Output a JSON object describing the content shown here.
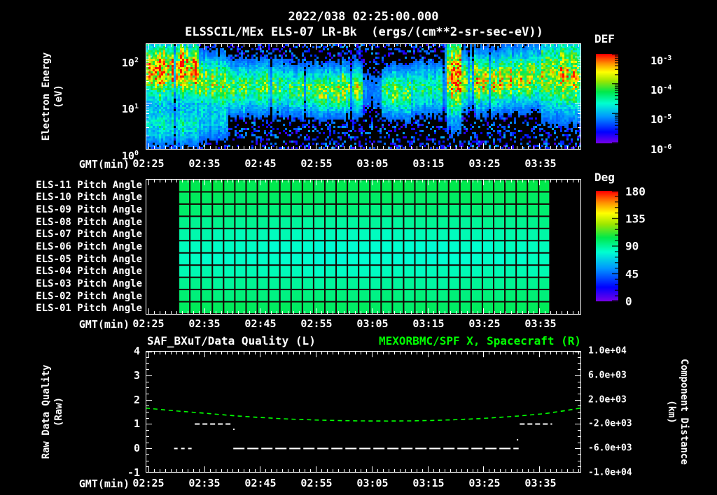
{
  "title": {
    "line1": "2022/038 02:25:00.000",
    "line2": "ELSSCIL/MEx ELS-07 LR-Bk  (ergs/(cm**2-sr-sec-eV))"
  },
  "colors": {
    "background": "#000000",
    "text": "#ffffff",
    "accent_green": "#00ff00",
    "panel_border": "#ffffff",
    "grid_line": "#150301"
  },
  "axis": {
    "gmt_label": "GMT(min)",
    "time_ticks": [
      "02:25",
      "02:35",
      "02:45",
      "02:55",
      "03:05",
      "03:15",
      "03:25",
      "03:35"
    ]
  },
  "panel1": {
    "ylabel_line1": "Electron Energy",
    "ylabel_line2": "(eV)",
    "yticks": [
      {
        "base": "10",
        "exp": "2"
      },
      {
        "base": "10",
        "exp": "1"
      },
      {
        "base": "10",
        "exp": "0"
      }
    ],
    "colorbar": {
      "title": "DEF",
      "tick_labels": [
        {
          "base": "10",
          "exp": "-3"
        },
        {
          "base": "10",
          "exp": "-4"
        },
        {
          "base": "10",
          "exp": "-5"
        },
        {
          "base": "10",
          "exp": "-6"
        }
      ]
    }
  },
  "panel2": {
    "row_labels": [
      "ELS-11 Pitch Angle",
      "ELS-10 Pitch Angle",
      "ELS-09 Pitch Angle",
      "ELS-08 Pitch Angle",
      "ELS-07 Pitch Angle",
      "ELS-06 Pitch Angle",
      "ELS-05 Pitch Angle",
      "ELS-04 Pitch Angle",
      "ELS-03 Pitch Angle",
      "ELS-02 Pitch Angle",
      "ELS-01 Pitch Angle"
    ],
    "colorbar": {
      "title": "Deg",
      "tick_labels": [
        "180",
        "135",
        "90",
        "45",
        "0"
      ]
    }
  },
  "panel3": {
    "title_left": "SAF_BXuT/Data Quality (L)",
    "title_right": "MEXORBMC/SPF X, Spacecraft (R)",
    "ylabel_left_line1": "Raw Data Quality",
    "ylabel_left_line2": "(Raw)",
    "ylabel_right_line1": "Component Distance",
    "ylabel_right_line2": "(km)",
    "yticks_left": [
      "4",
      "3",
      "2",
      "1",
      "0",
      "-1"
    ],
    "yticks_right": [
      "1.0e+04",
      "6.0e+03",
      "2.0e+03",
      "-2.0e+03",
      "-6.0e+03",
      "-1.0e+04"
    ]
  },
  "chart_data": [
    {
      "type": "heatmap",
      "name": "electron-energy-spectrogram",
      "title": "ELSSCIL/MEx ELS-07 LR-Bk",
      "units": "ergs/(cm**2-sr-sec-eV)",
      "colorbar_label": "DEF",
      "value_range": [
        "1e-6",
        "1e-3"
      ],
      "x_start_label": "02:25",
      "time_range_min": [
        -0.5,
        77.5
      ],
      "energy_log10_range": [
        0,
        2.28
      ],
      "rainbow_stops": [
        [
          0,
          "#7a00e6"
        ],
        [
          0.13,
          "#0000ff"
        ],
        [
          0.3,
          "#0096ff"
        ],
        [
          0.45,
          "#00ffd0"
        ],
        [
          0.58,
          "#00e84a"
        ],
        [
          0.7,
          "#9ce600"
        ],
        [
          0.8,
          "#ffff00"
        ],
        [
          0.9,
          "#ff8c00"
        ],
        [
          1,
          "#ff0000"
        ]
      ],
      "band_segments": [
        {
          "t": [
            -0.5,
            9
          ],
          "a": 0.95,
          "c": 1.72,
          "w": 0.38,
          "low": [
            0.34,
            0.55,
            0.28
          ]
        },
        {
          "t": [
            9,
            14
          ],
          "a": 0.6,
          "c": 1.45,
          "w": 0.34,
          "low": [
            0.2,
            0.6,
            0.25
          ]
        },
        {
          "t": [
            14,
            25
          ],
          "a": 0.5,
          "c": 1.35,
          "w": 0.32
        },
        {
          "t": [
            25,
            31
          ],
          "a": 0.55,
          "c": 1.28,
          "w": 0.3
        },
        {
          "t": [
            31,
            38
          ],
          "a": 0.62,
          "c": 1.3,
          "w": 0.3
        },
        {
          "t": [
            38,
            41.5
          ],
          "a": 0.12,
          "c": 1.3,
          "w": 0.3
        },
        {
          "t": [
            41.5,
            47
          ],
          "a": 0.55,
          "c": 1.25,
          "w": 0.3
        },
        {
          "t": [
            47,
            53
          ],
          "a": 0.4,
          "c": 1.32,
          "w": 0.32
        },
        {
          "t": [
            53,
            56
          ],
          "a": 0.82,
          "c": 1.58,
          "w": 0.55
        },
        {
          "t": [
            56,
            63
          ],
          "a": 0.7,
          "c": 1.5,
          "w": 0.34
        },
        {
          "t": [
            63,
            70
          ],
          "a": 0.66,
          "c": 1.55,
          "w": 0.36
        },
        {
          "t": [
            70,
            77.5
          ],
          "a": 0.68,
          "c": 1.62,
          "w": 0.5
        }
      ]
    },
    {
      "type": "heatmap",
      "name": "pitch-angle-panel",
      "colorbar_label": "Deg",
      "deg_range": [
        0,
        180
      ],
      "rows": 11,
      "row_labels_top_to_bottom": [
        "ELS-11",
        "ELS-10",
        "ELS-09",
        "ELS-08",
        "ELS-07",
        "ELS-06",
        "ELS-05",
        "ELS-04",
        "ELS-03",
        "ELS-02",
        "ELS-01"
      ],
      "data_time_range_min": [
        5.4,
        71.9
      ],
      "columns": 33,
      "row_base_pitch_deg": [
        104,
        101,
        98,
        93,
        88,
        85,
        84,
        87,
        92,
        97,
        101
      ]
    },
    {
      "type": "line",
      "name": "quality-and-spacecraft-x",
      "xlabel": "GMT(min)",
      "ylim_left": [
        -1,
        4
      ],
      "ylim_right": [
        -10000,
        10000
      ],
      "series": [
        {
          "name": "MEXORBMC/SPF X, Spacecraft (R)",
          "axis": "right",
          "color": "#00ff00",
          "style": "dashed",
          "points_t_km": [
            [
              -0.5,
              620
            ],
            [
              3,
              300
            ],
            [
              7,
              0
            ],
            [
              11,
              -300
            ],
            [
              15,
              -620
            ],
            [
              19,
              -880
            ],
            [
              23,
              -1090
            ],
            [
              27,
              -1260
            ],
            [
              31,
              -1380
            ],
            [
              35,
              -1460
            ],
            [
              39,
              -1505
            ],
            [
              43,
              -1515
            ],
            [
              47,
              -1490
            ],
            [
              51,
              -1420
            ],
            [
              55,
              -1300
            ],
            [
              59,
              -1130
            ],
            [
              63,
              -910
            ],
            [
              67,
              -640
            ],
            [
              71,
              -300
            ],
            [
              74,
              100
            ],
            [
              77.5,
              620
            ]
          ]
        },
        {
          "name": "SAF_BXuT/Data Quality (L)",
          "axis": "left",
          "color": "#ffffff",
          "style": "dashed-segments",
          "segments": [
            {
              "value": 0,
              "t": [
                4.6,
                8.2
              ],
              "dash": [
                5,
                5
              ]
            },
            {
              "value": 1,
              "t": [
                8.3,
                15.2
              ],
              "dash": [
                7,
                4
              ]
            },
            {
              "value": 0,
              "t": [
                15.2,
                66.3
              ],
              "dash": [
                16,
                4
              ]
            },
            {
              "value": 1,
              "t": [
                66.5,
                72.3
              ],
              "dash": [
                7,
                4
              ]
            }
          ],
          "dots_t_value": [
            [
              15.3,
              0.78
            ],
            [
              66.1,
              0.35
            ]
          ]
        }
      ]
    }
  ]
}
